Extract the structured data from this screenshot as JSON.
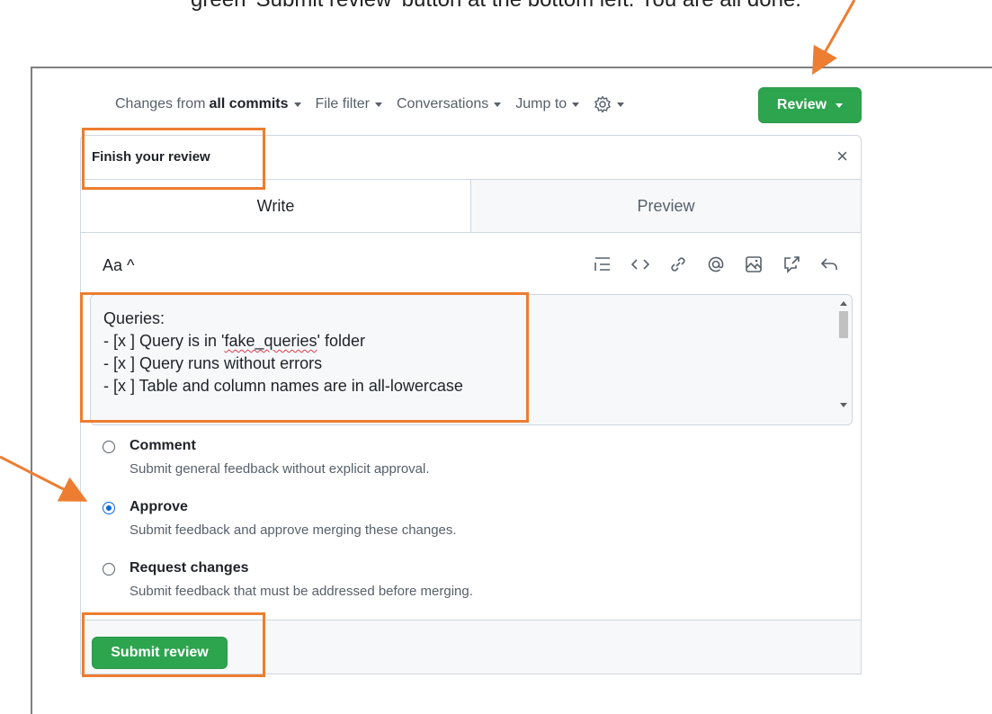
{
  "caption": "green 'Submit review' button at the bottom left. You are all done.",
  "toolbar": {
    "changes_prefix": "Changes from",
    "changes_value": "all commits",
    "file_filter": "File filter",
    "conversations": "Conversations",
    "jump_to": "Jump to",
    "review_label": "Review"
  },
  "panel": {
    "title": "Finish your review",
    "close": "×",
    "tabs": {
      "write": "Write",
      "preview": "Preview"
    },
    "aa_label": "Aa ^"
  },
  "textarea": {
    "lines": [
      "Queries:",
      "- [x ] Query is in 'fake_queries' folder",
      "- [x ] Query runs without errors",
      "- [x ] Table and column names are in all-lowercase"
    ],
    "line2_prefix": "- [x ] Query is in '",
    "line2_word": "fake_queries",
    "line2_suffix": "' folder"
  },
  "options": [
    {
      "label": "Comment",
      "desc": "Submit general feedback without explicit approval.",
      "selected": false
    },
    {
      "label": "Approve",
      "desc": "Submit feedback and approve merging these changes.",
      "selected": true
    },
    {
      "label": "Request changes",
      "desc": "Submit feedback that must be addressed before merging.",
      "selected": false
    }
  ],
  "submit_label": "Submit review",
  "colors": {
    "green": "#2da44e",
    "highlight": "#ed7d31",
    "radio_blue": "#0969da"
  },
  "icons": [
    "list-icon",
    "code-icon",
    "link-icon",
    "mention-icon",
    "image-icon",
    "reference-icon",
    "undo-icon",
    "gear-icon",
    "close-icon"
  ]
}
